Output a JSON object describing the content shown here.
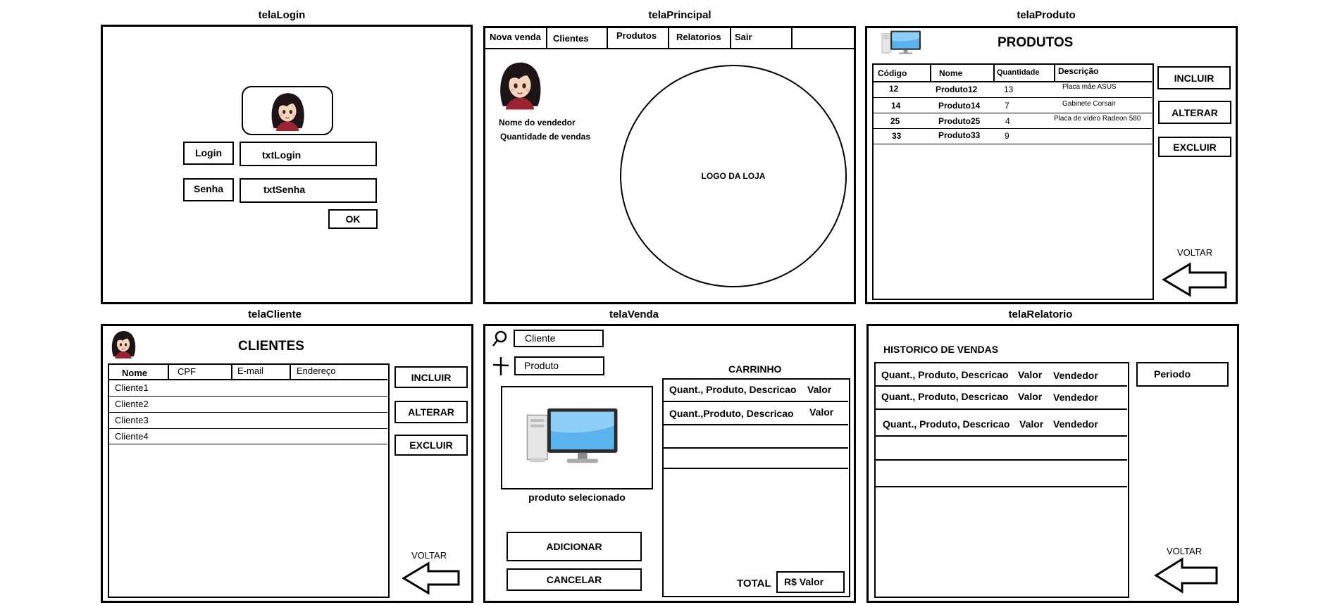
{
  "login": {
    "title": "telaLogin",
    "login_label": "Login",
    "login_field": "txtLogin",
    "password_label": "Senha",
    "password_field": "txtSenha",
    "ok_label": "OK"
  },
  "principal": {
    "title": "telaPrincipal",
    "menu": [
      "Nova venda",
      "Clientes",
      "Produtos",
      "Relatorios",
      "Sair"
    ],
    "seller_name": "Nome do vendedor",
    "sales_count": "Quantidade de vendas",
    "logo_text": "LOGO DA LOJA"
  },
  "produto": {
    "title": "telaProduto",
    "heading": "PRODUTOS",
    "columns": [
      "Código",
      "Nome",
      "Quantidade",
      "Descrição"
    ],
    "rows": [
      [
        "12",
        "Produto12",
        "13",
        "Placa mãe ASUS"
      ],
      [
        "14",
        "Produto14",
        "7",
        "Gabinete Corsair"
      ],
      [
        "25",
        "Produto25",
        "4",
        "Placa de vídeo Radeon 580"
      ],
      [
        "33",
        "Produto33",
        "9",
        ""
      ]
    ],
    "include_label": "INCLUIR",
    "alter_label": "ALTERAR",
    "delete_label": "EXCLUIR",
    "back_label": "VOLTAR"
  },
  "cliente": {
    "title": "telaCliente",
    "heading": "CLIENTES",
    "columns": [
      "Nome",
      "CPF",
      "E-mail",
      "Endereço"
    ],
    "rows": [
      "Cliente1",
      "Cliente2",
      "Cliente3",
      "Cliente4"
    ],
    "include_label": "INCLUIR",
    "alter_label": "ALTERAR",
    "delete_label": "EXCLUIR",
    "back_label": "VOLTAR"
  },
  "venda": {
    "title": "telaVenda",
    "client_field": "Cliente",
    "product_field": "Produto",
    "selected_caption": "produto selecionado",
    "cart_heading": "CARRINHO",
    "cart_rows": [
      [
        "Quant., Produto, Descricao",
        "Valor"
      ],
      [
        "Quant.,Produto, Descricao",
        "Valor"
      ]
    ],
    "add_label": "ADICIONAR",
    "cancel_label": "CANCELAR",
    "total_label": "TOTAL",
    "total_value": "R$ Valor"
  },
  "relatorio": {
    "title": "telaRelatorio",
    "heading": "HISTORICO DE VENDAS",
    "rows": [
      [
        "Quant., Produto, Descricao",
        "Valor",
        "Vendedor"
      ],
      [
        "Quant., Produto, Descricao",
        "Valor",
        "Vendedor"
      ],
      [
        "Quant., Produto, Descricao",
        "Valor",
        "Vendedor"
      ]
    ],
    "period_label": "Periodo",
    "back_label": "VOLTAR"
  },
  "icons": [
    "avatar-icon",
    "computer-icon",
    "search-icon",
    "plus-icon",
    "back-arrow-icon"
  ]
}
